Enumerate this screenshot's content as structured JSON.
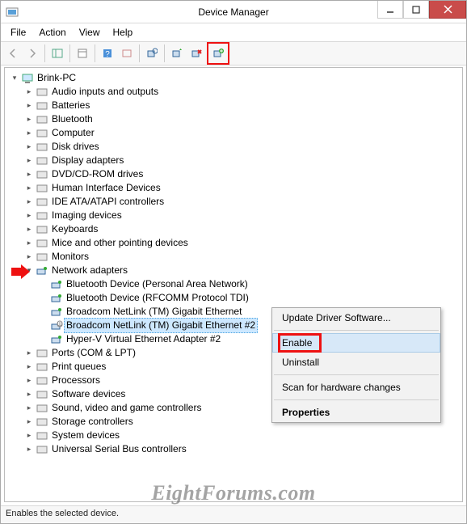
{
  "window": {
    "title": "Device Manager"
  },
  "menu": {
    "file": "File",
    "action": "Action",
    "view": "View",
    "help": "Help"
  },
  "tree": {
    "root": "Brink-PC",
    "items": [
      "Audio inputs and outputs",
      "Batteries",
      "Bluetooth",
      "Computer",
      "Disk drives",
      "Display adapters",
      "DVD/CD-ROM drives",
      "Human Interface Devices",
      "IDE ATA/ATAPI controllers",
      "Imaging devices",
      "Keyboards",
      "Mice and other pointing devices",
      "Monitors"
    ],
    "network_adapters": {
      "label": "Network adapters",
      "children": [
        "Bluetooth Device (Personal Area Network)",
        "Bluetooth Device (RFCOMM Protocol TDI)",
        "Broadcom NetLink (TM) Gigabit Ethernet",
        "Broadcom NetLink (TM) Gigabit Ethernet #2",
        "Hyper-V Virtual Ethernet Adapter #2"
      ]
    },
    "items_after": [
      "Ports (COM & LPT)",
      "Print queues",
      "Processors",
      "Software devices",
      "Sound, video and game controllers",
      "Storage controllers",
      "System devices",
      "Universal Serial Bus controllers"
    ]
  },
  "context_menu": {
    "update": "Update Driver Software...",
    "enable": "Enable",
    "uninstall": "Uninstall",
    "scan": "Scan for hardware changes",
    "properties": "Properties"
  },
  "status": "Enables the selected device.",
  "watermark": "EightForums.com"
}
